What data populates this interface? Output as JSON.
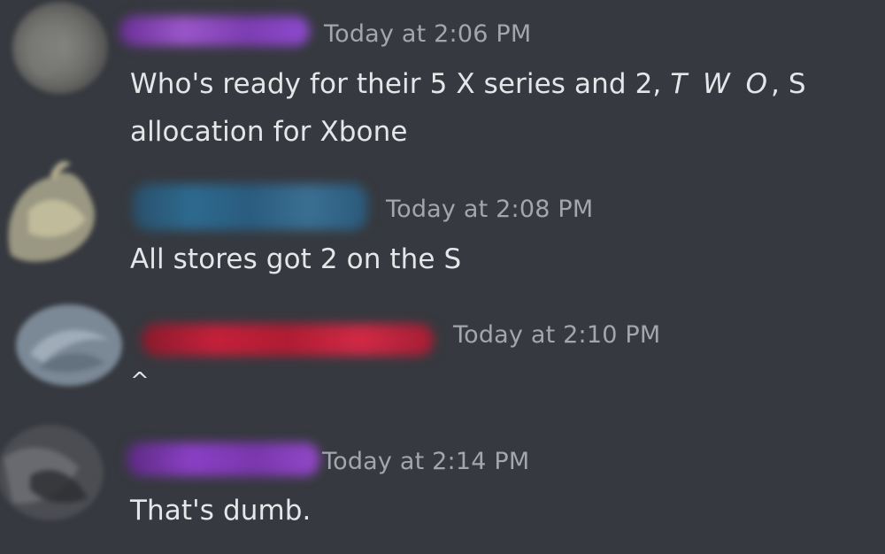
{
  "messages": [
    {
      "timestamp": "Today at 2:06 PM",
      "text_before": "Who's ready for their 5 X series and 2, ",
      "text_italic": "T W O",
      "text_after": ", S allocation for Xbone",
      "username_color": "#8e44c9"
    },
    {
      "timestamp": "Today at 2:08 PM",
      "text": "All stores got 2 on the S",
      "username_color": "#2e6e96"
    },
    {
      "timestamp": "Today at 2:10 PM",
      "text": "^",
      "username_color": "#c4203a"
    },
    {
      "timestamp": "Today at 2:14 PM",
      "text": "That's dumb.",
      "username_color": "#8a3fc4"
    }
  ],
  "theme": {
    "background": "#36393f",
    "timestamp_color": "#a3a6aa",
    "text_color": "#e4e6e8"
  }
}
